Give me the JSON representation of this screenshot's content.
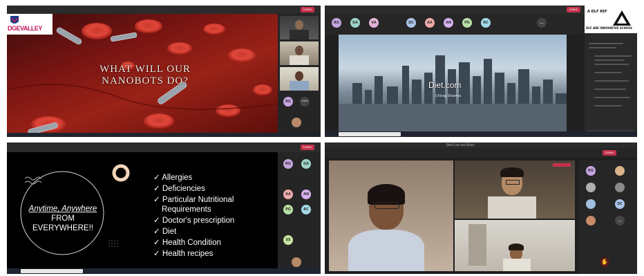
{
  "q1": {
    "logo_text": "DGEVALLEY",
    "slide_title_line1": "WHAT WILL OUR",
    "slide_title_line2": "NANOBOTS DO?",
    "participants": [
      {
        "initials": "RG",
        "color": "#c7a4e0"
      }
    ]
  },
  "q2": {
    "meeting_title": "Diet.com",
    "slide_subtitle": "Chirag Sharma",
    "school_name": "DLF ARE INNOVATIVE SCHOOL",
    "school_letters": "A DLF REF",
    "participants": [
      {
        "initials": "RG",
        "color": "#c7a4e0"
      },
      {
        "initials": "GA",
        "color": "#9fd3c7"
      },
      {
        "initials": "VA",
        "color": "#e5b3d8"
      },
      {
        "initials": "",
        "color": "#8a8a8a"
      },
      {
        "initials": "DC",
        "color": "#aac4ea"
      },
      {
        "initials": "AA",
        "color": "#f0a9a9"
      },
      {
        "initials": "AN",
        "color": "#d6b0f0"
      },
      {
        "initials": "PG",
        "color": "#b9e0a5"
      },
      {
        "initials": "RC",
        "color": "#a3d9e8"
      },
      {
        "initials": "",
        "color": "#8a7a6a"
      },
      {
        "initials": "",
        "color": "#6a6a6a"
      },
      {
        "initials": "...",
        "color": "#444444"
      }
    ]
  },
  "q3": {
    "slogan_line1": "Anytime, Anywhere",
    "slogan_line2": "FROM",
    "slogan_line3": "EVERYWHERE!!",
    "bullets": [
      "Allergies",
      "Deficiencies",
      "Particular Nutritional",
      "Requirements",
      "Doctor's prescription",
      "Diet",
      "Health Condition",
      "Health recipes"
    ],
    "participants": [
      {
        "initials": "RG",
        "color": "#c7a4e0"
      },
      {
        "initials": "GA",
        "color": "#9fd3c7"
      },
      {
        "initials": "",
        "color": "#8a8a8a"
      },
      {
        "initials": "",
        "color": "#777777"
      },
      {
        "initials": "AA",
        "color": "#f0a9a9"
      },
      {
        "initials": "AN",
        "color": "#d6b0f0"
      },
      {
        "initials": "PG",
        "color": "#b9e0a5"
      },
      {
        "initials": "RC",
        "color": "#a3d9e8"
      },
      {
        "initials": "",
        "color": "#8a7a6a"
      },
      {
        "initials": "",
        "color": "#6a6a6a"
      },
      {
        "initials": "SS",
        "color": "#c8e6a0"
      },
      {
        "initials": "",
        "color": "#555555"
      }
    ]
  },
  "q4": {
    "window_title": "Diet Cure and Strain",
    "participants": [
      {
        "initials": "RG",
        "color": "#c7a4e0"
      },
      {
        "initials": "",
        "color": "#d9b38c"
      },
      {
        "initials": "",
        "color": "#b0b0b0"
      },
      {
        "initials": "",
        "color": "#8a8a8a"
      },
      {
        "initials": "",
        "color": "#a0c0e0"
      },
      {
        "initials": "DC",
        "color": "#aac4ea"
      },
      {
        "initials": "",
        "color": "#c98a6a"
      },
      {
        "initials": "...",
        "color": "#444444"
      }
    ]
  },
  "colors": {
    "teams_red": "#c4314b",
    "slide_red": "#8b1a16",
    "dark_bg": "#1b1b1b"
  }
}
